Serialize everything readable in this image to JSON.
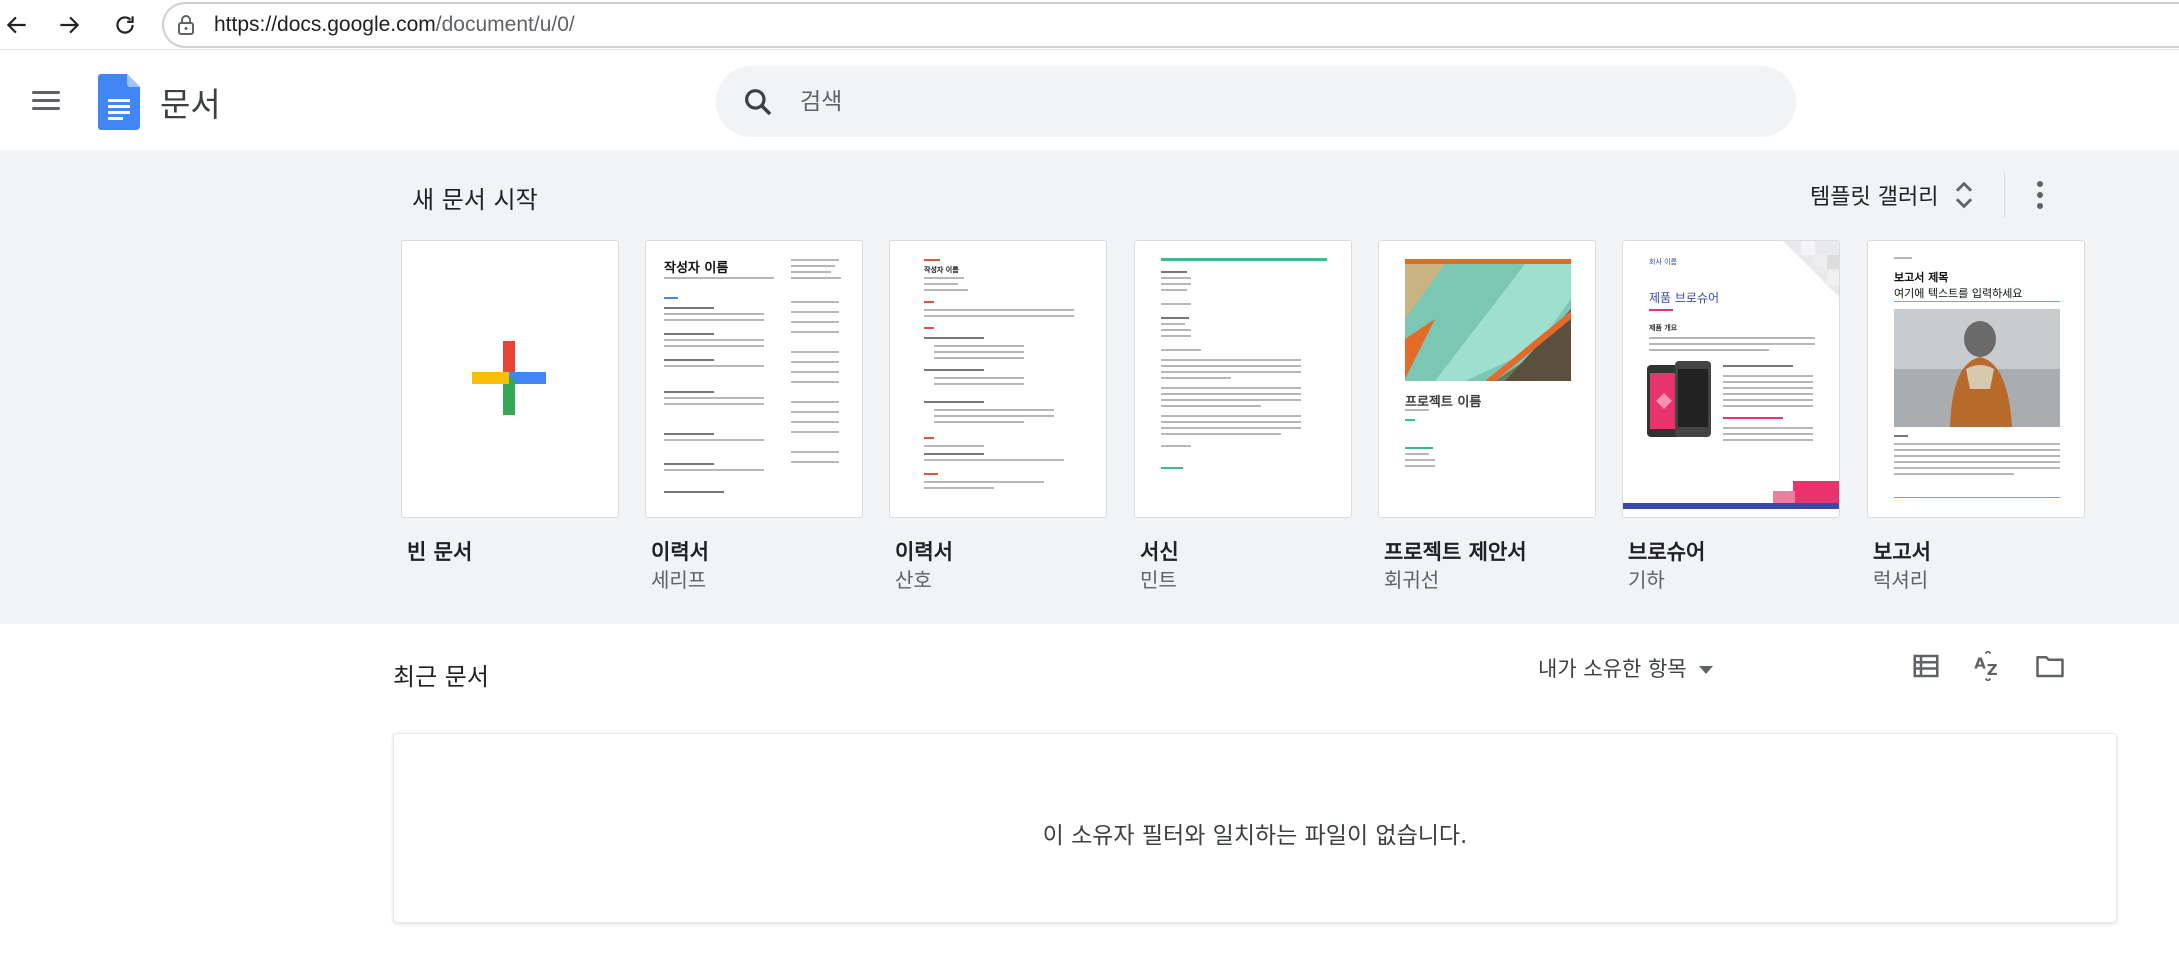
{
  "browser": {
    "url_host": "https://docs.google.com",
    "url_path": "/document/u/0/"
  },
  "header": {
    "app_title": "문서",
    "search_placeholder": "검색"
  },
  "templates": {
    "section_title": "새 문서 시작",
    "gallery_label": "템플릿 갤러리",
    "items": [
      {
        "name": "빈 문서",
        "sub": ""
      },
      {
        "name": "이력서",
        "sub": "세리프",
        "heading": "작성자 이름"
      },
      {
        "name": "이력서",
        "sub": "산호",
        "heading": "작성자 이름"
      },
      {
        "name": "서신",
        "sub": "민트"
      },
      {
        "name": "프로젝트 제안서",
        "sub": "회귀선",
        "heading": "프로젝트 이름"
      },
      {
        "name": "브로슈어",
        "sub": "기하",
        "heading": "제품 브로슈어",
        "kicker": "회사 이름",
        "section": "제품 개요"
      },
      {
        "name": "보고서",
        "sub": "럭셔리",
        "heading": "보고서 제목",
        "subheading": "여기에 텍스트를 입력하세요"
      }
    ]
  },
  "recent": {
    "title": "최근 문서",
    "owner_filter": "내가 소유한 항목",
    "empty_message": "이 소유자 필터와 일치하는 파일이 없습니다."
  },
  "colors": {
    "docs_blue": "#4285f4",
    "google_red": "#ea4335",
    "google_yellow": "#fbbc04",
    "google_green": "#34a853",
    "coral": "#e0523e",
    "mint": "#3fba8f",
    "brochure_pink": "#e8336d",
    "luxury_orange": "#e8883a"
  }
}
